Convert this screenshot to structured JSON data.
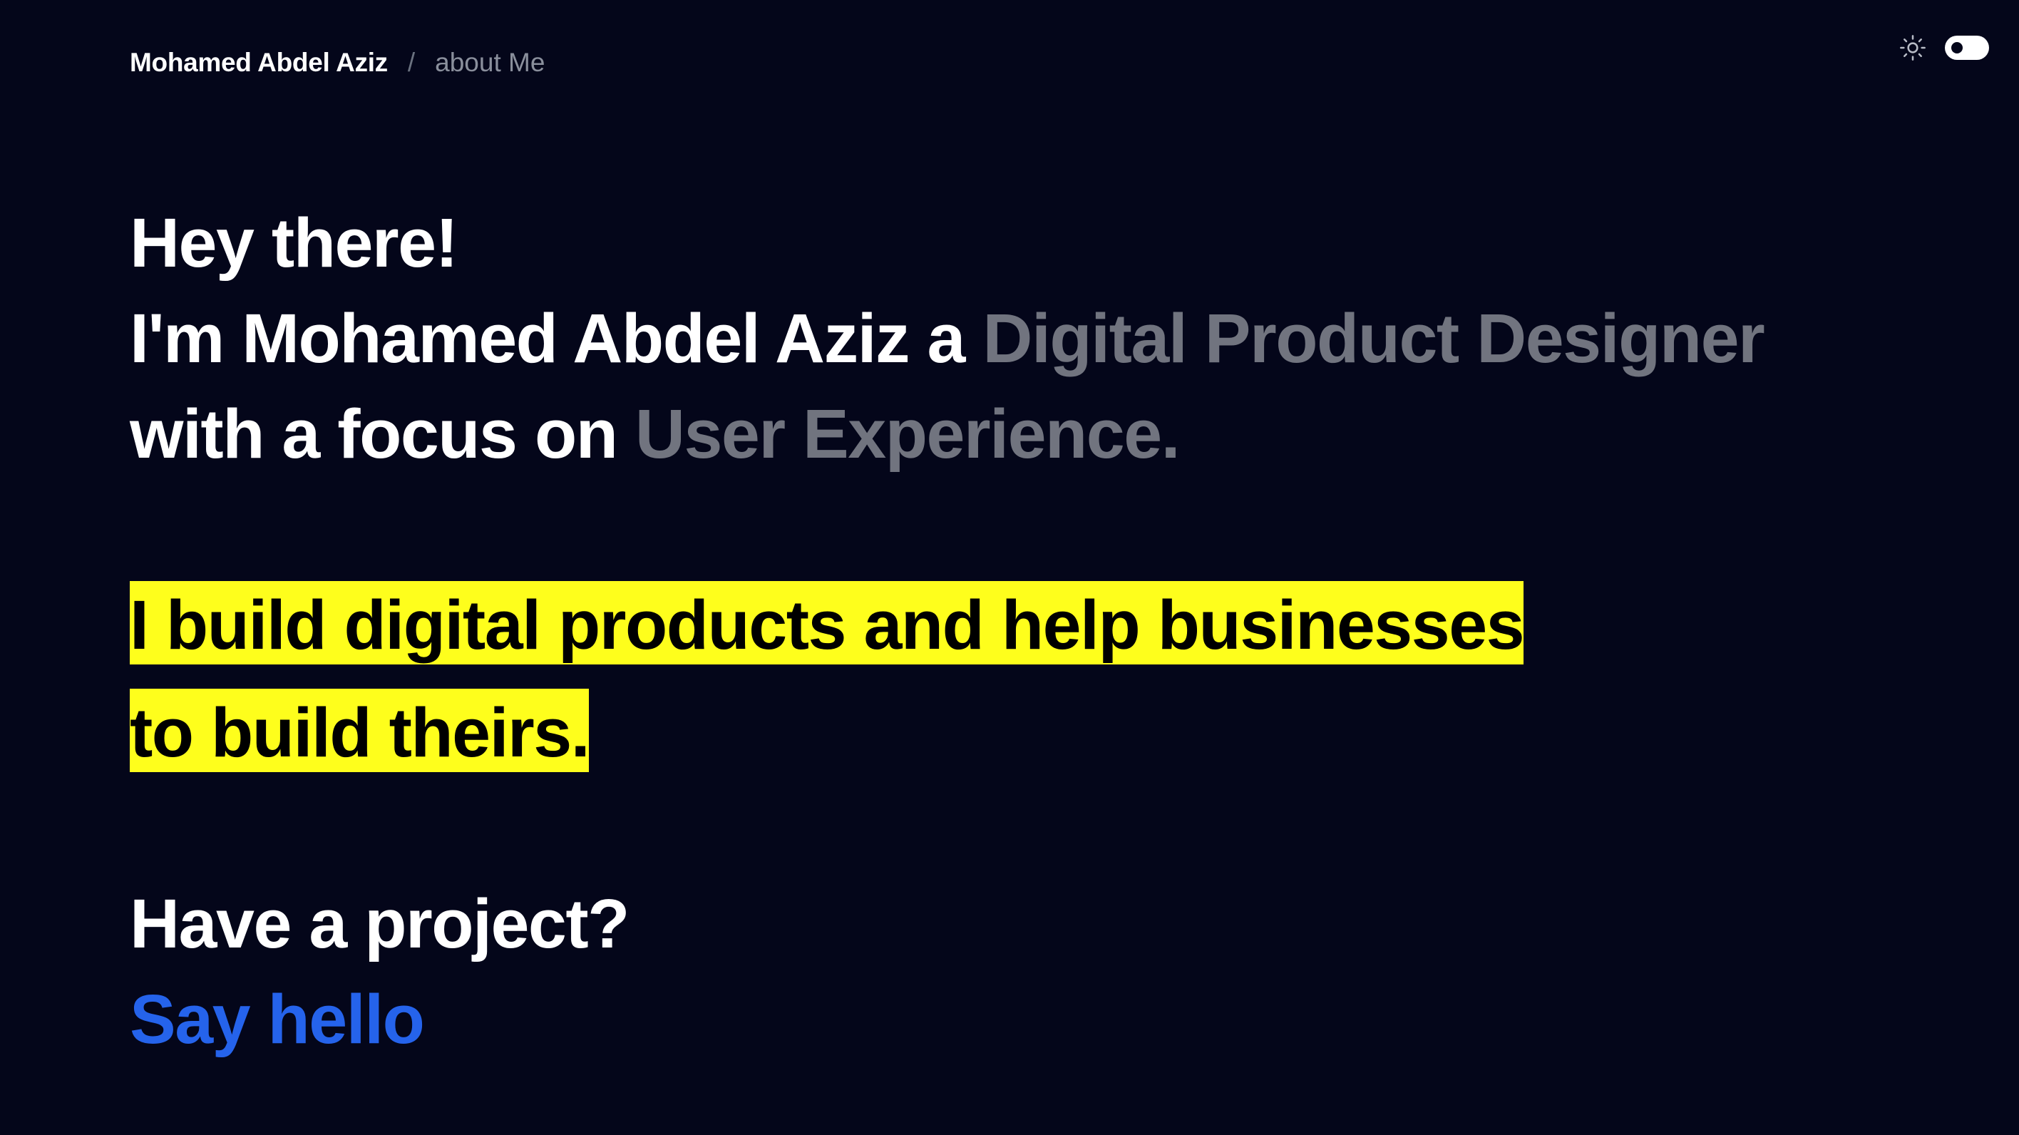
{
  "breadcrumb": {
    "home": "Mohamed Abdel Aziz",
    "separator": "/",
    "current": "about Me"
  },
  "theme": {
    "icon": "sun-icon",
    "toggle_state": "dark"
  },
  "intro": {
    "greeting": "Hey there!",
    "name_prefix": "I'm Mohamed Abdel Aziz a ",
    "role": "Digital Product Designer",
    "focus_prefix": " with a focus on ",
    "focus": "User Experience."
  },
  "highlight": {
    "line1": "I build digital products and help businesses",
    "line2": "to build theirs."
  },
  "cta": {
    "question": "Have a project?",
    "link_label": "Say hello"
  },
  "colors": {
    "background": "#04061a",
    "primary_text": "#ffffff",
    "muted_text": "#71747f",
    "highlight_bg": "#fefe1c",
    "link": "#2563eb"
  }
}
